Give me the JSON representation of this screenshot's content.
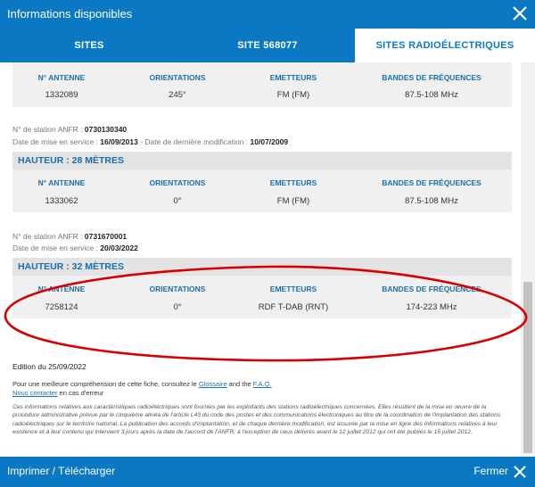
{
  "window": {
    "title": "Informations disponibles"
  },
  "tabs": [
    {
      "label": "SITES"
    },
    {
      "label": "SITE 568077"
    },
    {
      "label": "SITES RADIOÉLECTRIQUES"
    }
  ],
  "columns": {
    "antenna": "N° ANTENNE",
    "orientations": "ORIENTATIONS",
    "emitters": "EMETTEURS",
    "bands": "BANDES DE FRÉQUENCES"
  },
  "stations": [
    {
      "rows": [
        {
          "antenna": "1332089",
          "orientation": "245°",
          "emitter": "FM (FM)",
          "band": "87.5-108 MHz"
        }
      ]
    },
    {
      "station_label": "N° de station ANFR :",
      "station_number": "0730130340",
      "service_label": "Date de mise en service :",
      "service_date": "16/09/2013",
      "modified_label": " - Date de dernière modification :",
      "modified_date": "10/07/2009",
      "height": "HAUTEUR : 28 MÈTRES",
      "rows": [
        {
          "antenna": "1333062",
          "orientation": "0°",
          "emitter": "FM (FM)",
          "band": "87.5-108 MHz"
        }
      ]
    },
    {
      "station_label": "N° de station ANFR :",
      "station_number": "0731670001",
      "service_label": "Date de mise en service :",
      "service_date": "20/03/2022",
      "height": "HAUTEUR : 32 MÈTRES",
      "rows": [
        {
          "antenna": "7258124",
          "orientation": "0°",
          "emitter": "RDF T-DAB (RNT)",
          "band": "174-223 MHz"
        }
      ]
    }
  ],
  "edition": "Edition du 25/09/2022",
  "help": {
    "line1_prefix": "Pour une meilleure compréhension de cette fiche, consultez le ",
    "glossary": "Glossaire",
    "and": " and the ",
    "faq": "F.A.Q.",
    "contact": "Nous contacter",
    "contact_suffix": " en cas d'erreur"
  },
  "legal": "Ces informations relatives aux caractéristiques radioélectriques sont fournies par les exploitants des stations radioélectriques concernées. Elles résultent de la mise en œuvre de la procédure administrative prévue par le cinquième alinéa de l'article L43 du code des postes et des communications électroniques au titre de la coordination de l'implantation des stations radioélectriques sur le territoire national. La publication des accords d'implantation, et de chaque dernière modification, est assurée par la mise en ligne des informations relatives à leur existence et à leur contenu qui intervient 3 jours après la date de l'accord de l'ANFR, à l'exception de ceux délivrés avant le 12 juillet 2012 qui ont été publiés le 15 juillet 2012.",
  "footer": {
    "print": "Imprimer / Télécharger",
    "close": "Fermer"
  },
  "colors": {
    "brand": "#0a78c2",
    "annotation": "#d60000"
  }
}
